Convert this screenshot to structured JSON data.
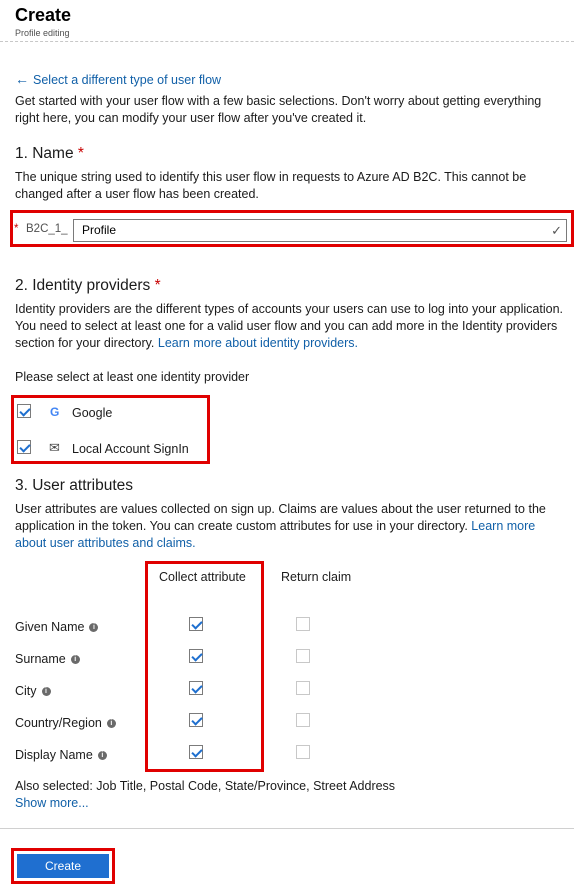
{
  "header": {
    "title": "Create",
    "subtitle": "Profile editing"
  },
  "back_link": {
    "arrow": "←",
    "label": "Select a different type of user flow"
  },
  "intro": "Get started with your user flow with a few basic selections. Don't worry about getting everything right here, you can modify your user flow after you've created it.",
  "name_section": {
    "heading": "1. Name",
    "required_marker": "*",
    "description": "The unique string used to identify this user flow in requests to Azure AD B2C. This cannot be changed after a user flow has been created.",
    "prefix_required": "*",
    "prefix": "B2C_1_",
    "value": "Profile",
    "valid_icon": "checkmark-icon",
    "valid_glyph": "✓"
  },
  "identity_section": {
    "heading": "2. Identity providers",
    "required_marker": "*",
    "description": "Identity providers are the different types of accounts your users can use to log into your application. You need to select at least one for a valid user flow and you can add more in the Identity providers section for your directory.",
    "learn_more": "Learn more about identity providers.",
    "prompt": "Please select at least one identity provider",
    "providers": [
      {
        "label": "Google",
        "checked": true,
        "icon": "google-icon",
        "glyph": "G"
      },
      {
        "label": "Local Account SignIn",
        "checked": true,
        "icon": "envelope-icon",
        "glyph": "✉"
      }
    ]
  },
  "attributes_section": {
    "heading": "3. User attributes",
    "description": "User attributes are values collected on sign up. Claims are values about the user returned to the application in the token. You can create custom attributes for use in your directory.",
    "learn_more": "Learn more about user attributes and claims.",
    "column_collect": "Collect attribute",
    "column_return": "Return claim",
    "info_glyph": "i",
    "rows": [
      {
        "label": "Given Name",
        "collect": true,
        "return": false
      },
      {
        "label": "Surname",
        "collect": true,
        "return": false
      },
      {
        "label": "City",
        "collect": true,
        "return": false
      },
      {
        "label": "Country/Region",
        "collect": true,
        "return": false
      },
      {
        "label": "Display Name",
        "collect": true,
        "return": false
      }
    ],
    "also_selected": "Also selected: Job Title, Postal Code, State/Province, Street Address",
    "show_more": "Show more..."
  },
  "footer": {
    "create_label": "Create"
  },
  "colors": {
    "accent": "#1f6fd0",
    "link": "#1160a8",
    "highlight": "#e00000",
    "required": "#c80000"
  }
}
